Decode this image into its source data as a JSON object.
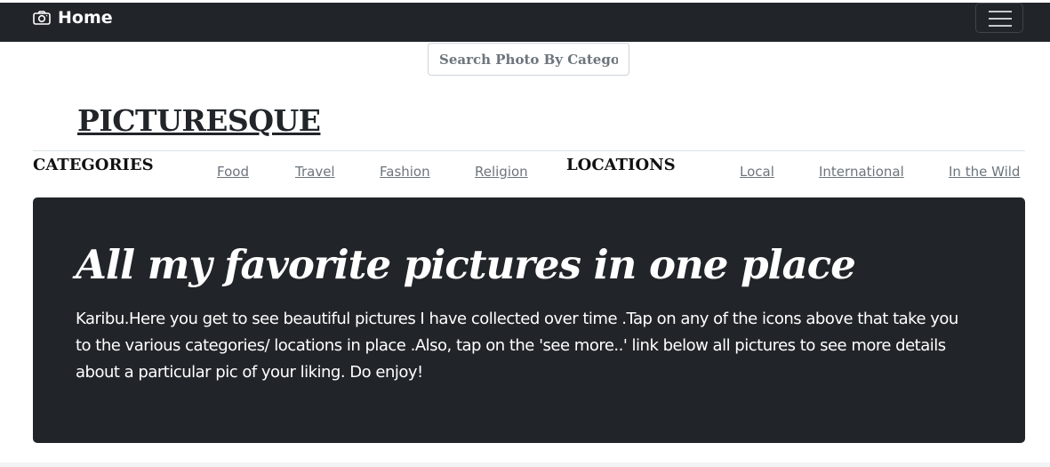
{
  "navbar": {
    "brand_icon": "camera-icon",
    "brand_label": "Home",
    "toggler_icon": "hamburger-menu-icon"
  },
  "search": {
    "placeholder": "Search Photo By Category"
  },
  "site": {
    "title": "PICTURESQUE"
  },
  "categories": {
    "heading": "CATEGORIES",
    "items": [
      "Food",
      "Travel",
      "Fashion",
      "Religion"
    ]
  },
  "locations": {
    "heading": "LOCATIONS",
    "items": [
      "Local",
      "International",
      "In the Wild"
    ]
  },
  "jumbotron": {
    "heading": "All my favorite pictures in one place",
    "text": "Karibu.Here you get to see beautiful pictures I have collected over time .Tap on any of the icons above that take you to the various categories/ locations in place .Also, tap on the 'see more..' link below all pictures to see more details about a particular pic of your liking. Do enjoy!"
  },
  "colors": {
    "dark": "#212529",
    "muted_link": "#6c757d",
    "white": "#ffffff"
  }
}
